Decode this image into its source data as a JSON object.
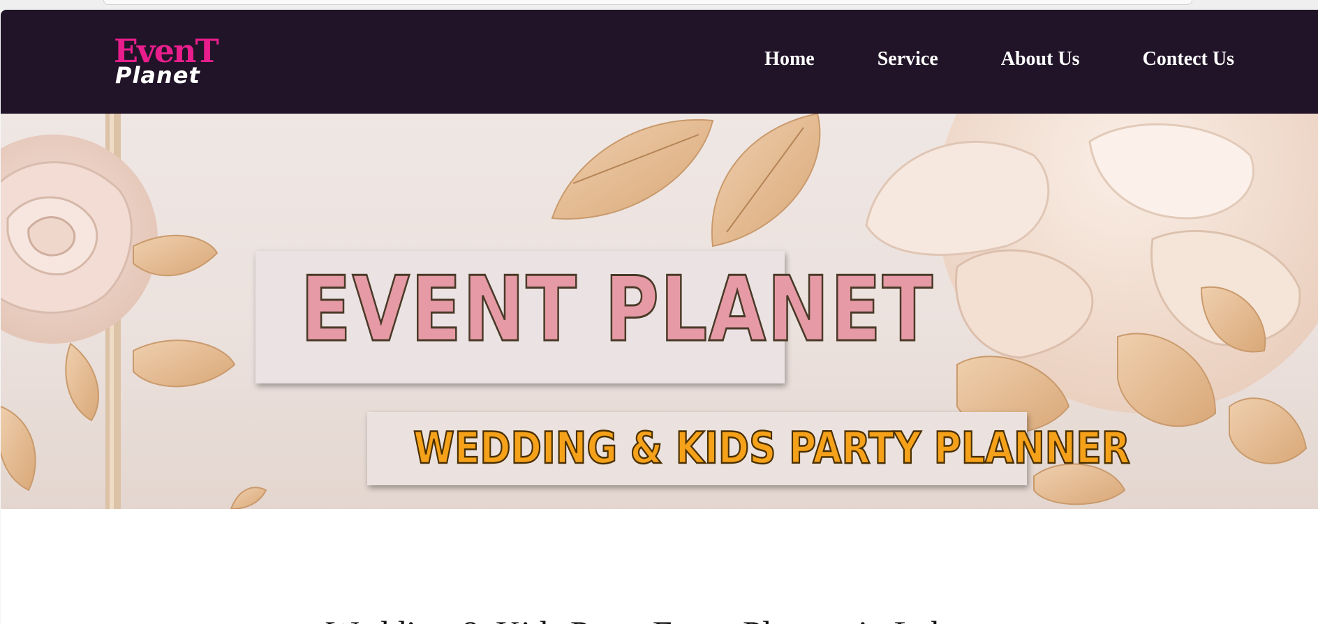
{
  "brand": {
    "logo_top": "EvenT",
    "logo_bottom": "Planet",
    "logo_color": "#e91e8c"
  },
  "nav": {
    "background": "#211428",
    "items": [
      {
        "label": "Home"
      },
      {
        "label": "Service"
      },
      {
        "label": "About Us"
      },
      {
        "label": "Contect Us"
      }
    ]
  },
  "hero": {
    "title": "EVENT PLANET",
    "subtitle": "WEDDING & KIDS PARTY PLANNER",
    "title_color": "#e69aa6",
    "subtitle_color": "#f5a11a",
    "decor": "paper-rose-and-leaf-icons"
  },
  "intro": {
    "heading": "Wedding & Kids Party Event Planner in Lahore"
  }
}
